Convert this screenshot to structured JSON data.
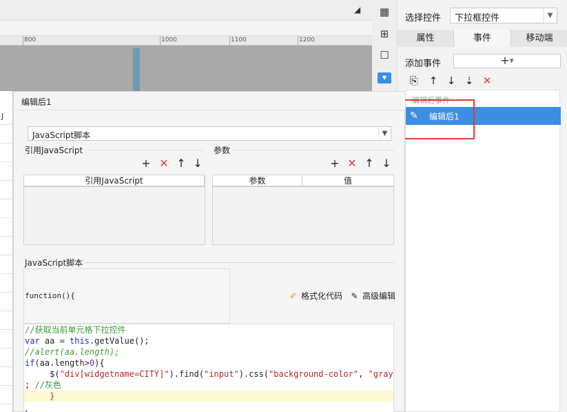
{
  "ruler": {
    "ticks": [
      "800",
      "1000",
      "1100",
      "1200"
    ]
  },
  "right_panel": {
    "select_control_label": "选择控件",
    "select_control_value": "下拉框控件",
    "tabs": [
      {
        "label": "属性",
        "active": false
      },
      {
        "label": "事件",
        "active": true
      },
      {
        "label": "移动端",
        "active": false
      }
    ],
    "add_event_label": "添加事件",
    "add_event_button": "+",
    "event_group": "编辑后事件",
    "event_item": "编辑后1"
  },
  "left_column": {
    "header": "J"
  },
  "dialog": {
    "title": "编辑后1",
    "type_value": "JavaScript脚本",
    "ref_section": "引用JavaScript",
    "param_section": "参数",
    "ref_table_header": "引用JavaScript",
    "param_table_headers": [
      "参数",
      "值"
    ],
    "script_section": "JavaScript脚本",
    "function_text": "function(){",
    "format_button": "格式化代码",
    "advanced_button": "高级编辑",
    "code_lines": [
      "//获取当前单元格下拉控件",
      "var aa = this.getValue();",
      "//alert(aa.length);",
      "if(aa.length>0){",
      "     $(\"div[widgetname=CITY]\").find(\"input\").css(\"background-color\", \"gray\")",
      "; //灰色",
      "     }"
    ],
    "closing": "}"
  },
  "colors": {
    "accent": "#3c8ee0",
    "delete": "#e23b3b",
    "highlight_box": "#e53935"
  }
}
